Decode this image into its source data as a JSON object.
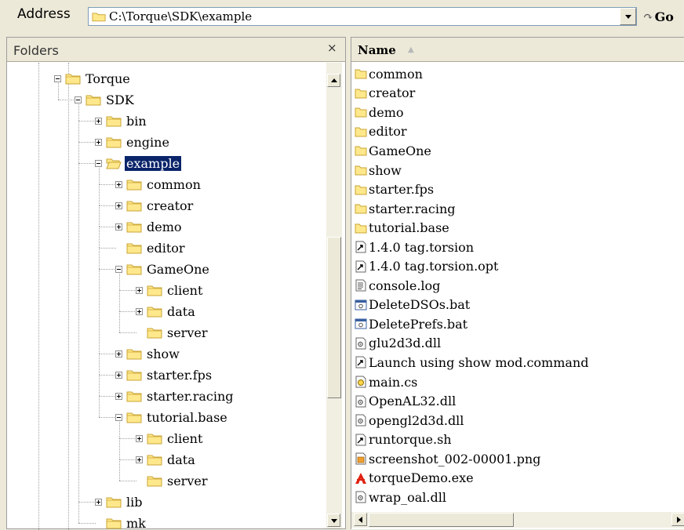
{
  "address_bar": {
    "label": "Address",
    "path": "C:\\Torque\\SDK\\example",
    "go_label": "Go"
  },
  "folders_pane": {
    "title": "Folders",
    "close_glyph": "×",
    "tree": [
      {
        "label": "Torque",
        "depth": 0,
        "expander": "minus"
      },
      {
        "label": "SDK",
        "depth": 1,
        "expander": "minus"
      },
      {
        "label": "bin",
        "depth": 2,
        "expander": "plus"
      },
      {
        "label": "engine",
        "depth": 2,
        "expander": "plus"
      },
      {
        "label": "example",
        "depth": 2,
        "expander": "minus",
        "selected": true,
        "open": true
      },
      {
        "label": "common",
        "depth": 3,
        "expander": "plus"
      },
      {
        "label": "creator",
        "depth": 3,
        "expander": "plus"
      },
      {
        "label": "demo",
        "depth": 3,
        "expander": "plus"
      },
      {
        "label": "editor",
        "depth": 3,
        "expander": "none"
      },
      {
        "label": "GameOne",
        "depth": 3,
        "expander": "minus"
      },
      {
        "label": "client",
        "depth": 4,
        "expander": "plus"
      },
      {
        "label": "data",
        "depth": 4,
        "expander": "plus"
      },
      {
        "label": "server",
        "depth": 4,
        "expander": "none"
      },
      {
        "label": "show",
        "depth": 3,
        "expander": "plus"
      },
      {
        "label": "starter.fps",
        "depth": 3,
        "expander": "plus"
      },
      {
        "label": "starter.racing",
        "depth": 3,
        "expander": "plus"
      },
      {
        "label": "tutorial.base",
        "depth": 3,
        "expander": "minus"
      },
      {
        "label": "client",
        "depth": 4,
        "expander": "plus"
      },
      {
        "label": "data",
        "depth": 4,
        "expander": "plus"
      },
      {
        "label": "server",
        "depth": 4,
        "expander": "none"
      },
      {
        "label": "lib",
        "depth": 2,
        "expander": "plus"
      },
      {
        "label": "mk",
        "depth": 2,
        "expander": "none"
      }
    ]
  },
  "list_pane": {
    "column_name": "Name",
    "sort_glyph": "▲",
    "files": [
      {
        "name": "common",
        "icon": "folder-icon"
      },
      {
        "name": "creator",
        "icon": "folder-icon"
      },
      {
        "name": "demo",
        "icon": "folder-icon"
      },
      {
        "name": "editor",
        "icon": "folder-icon"
      },
      {
        "name": "GameOne",
        "icon": "folder-icon"
      },
      {
        "name": "show",
        "icon": "folder-icon"
      },
      {
        "name": "starter.fps",
        "icon": "folder-icon"
      },
      {
        "name": "starter.racing",
        "icon": "folder-icon"
      },
      {
        "name": "tutorial.base",
        "icon": "folder-icon"
      },
      {
        "name": "1.4.0 tag.torsion",
        "icon": "shortcut-file-icon"
      },
      {
        "name": "1.4.0 tag.torsion.opt",
        "icon": "shortcut-file-icon"
      },
      {
        "name": "console.log",
        "icon": "text-file-icon"
      },
      {
        "name": "DeleteDSOs.bat",
        "icon": "batch-file-icon"
      },
      {
        "name": "DeletePrefs.bat",
        "icon": "batch-file-icon"
      },
      {
        "name": "glu2d3d.dll",
        "icon": "dll-file-icon"
      },
      {
        "name": "Launch using show mod.command",
        "icon": "shortcut-file-icon"
      },
      {
        "name": "main.cs",
        "icon": "script-file-icon"
      },
      {
        "name": "OpenAL32.dll",
        "icon": "dll-file-icon"
      },
      {
        "name": "opengl2d3d.dll",
        "icon": "dll-file-icon"
      },
      {
        "name": "runtorque.sh",
        "icon": "shortcut-file-icon"
      },
      {
        "name": "screenshot_002-00001.png",
        "icon": "image-file-icon"
      },
      {
        "name": "torqueDemo.exe",
        "icon": "torque-exe-icon"
      },
      {
        "name": "wrap_oal.dll",
        "icon": "dll-file-icon"
      }
    ]
  },
  "colors": {
    "selection": "#0a246a",
    "folder_fill": "#ffe88c",
    "folder_stroke": "#c9a433",
    "chrome": "#ece9d8"
  }
}
